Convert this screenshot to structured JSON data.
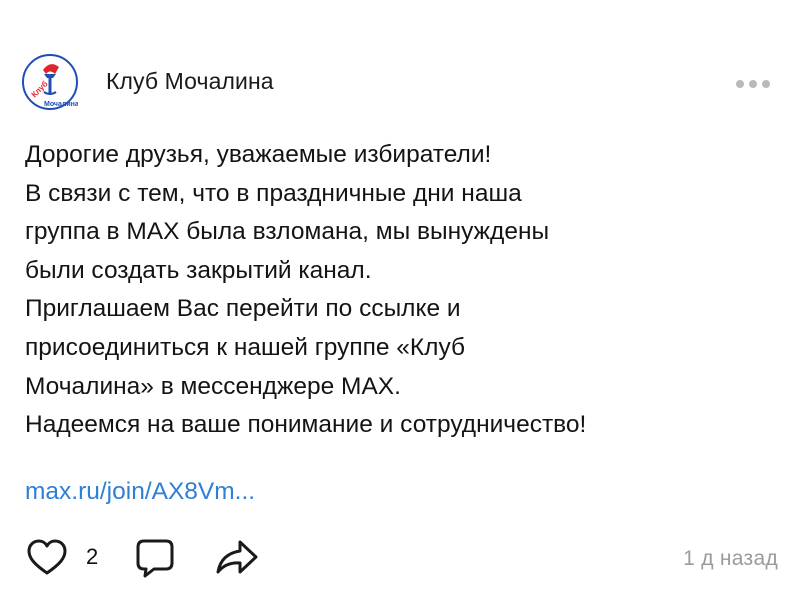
{
  "channel": {
    "name": "Клуб Мочалина",
    "logo_text": "Клуб Мочалина"
  },
  "post": {
    "lines": [
      "Дорогие друзья, уважаемые избиратели!",
      "В связи с тем, что в праздничные дни наша",
      "группа в MAX была взломана, мы вынуждены",
      "были создать закрытий канал.",
      "Приглашаем Вас перейти по ссылке и",
      "присоединиться к нашей группе «Клуб",
      "Мочалина» в мессенджере MAX.",
      "Надеемся на ваше понимание и сотрудничество!"
    ],
    "link": "max.ru/join/AX8Vm..."
  },
  "actions": {
    "like_count": "2",
    "timestamp": "1 д назад"
  },
  "icons": [
    "logo",
    "more-icon",
    "heart-icon",
    "comment-icon",
    "share-icon"
  ],
  "colors": {
    "link": "#2f7fd4",
    "meta": "#9a9aa0",
    "logo_blue": "#1f4fb5",
    "logo_red": "#e0242b"
  }
}
